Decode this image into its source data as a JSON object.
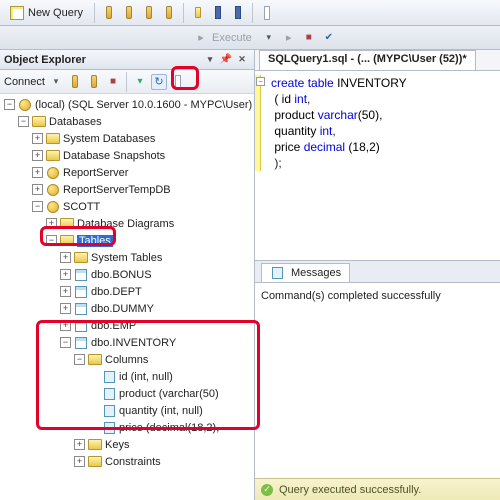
{
  "toolbar": {
    "new_query": "New Query"
  },
  "exec": {
    "execute": "Execute"
  },
  "explorer": {
    "title": "Object Explorer",
    "connect": "Connect",
    "server": "(local) (SQL Server 10.0.1600 - MYPC\\User)",
    "databases": "Databases",
    "system_databases": "System Databases",
    "snapshots": "Database Snapshots",
    "reportserver": "ReportServer",
    "reportservertemp": "ReportServerTempDB",
    "scott": "SCOTT",
    "diagrams": "Database Diagrams",
    "tables": "Tables",
    "system_tables": "System Tables",
    "bonus": "dbo.BONUS",
    "dept": "dbo.DEPT",
    "dummy": "dbo.DUMMY",
    "emp": "dbo.EMP",
    "inventory": "dbo.INVENTORY",
    "columns": "Columns",
    "col_id": "id (int, null)",
    "col_product": "product (varchar(50)",
    "col_quantity": "quantity (int, null)",
    "col_price": "price (decimal(18,2),",
    "keys": "Keys",
    "constraints": "Constraints"
  },
  "editor": {
    "tab_title": "SQLQuery1.sql - (... (MYPC\\User (52))*",
    "l1a": "create",
    "l1b": "table",
    "l1c": "INVENTORY",
    "l2a": "( id",
    "l2b": "int",
    "l2c": ",",
    "l3a": "product",
    "l3b": "varchar",
    "l3c": "(50),",
    "l4a": "quantity",
    "l4b": "int",
    "l4c": ",",
    "l5a": "price",
    "l5b": "decimal",
    "l5c": "(18,2)",
    "l6": ");"
  },
  "messages": {
    "tab": "Messages",
    "text": "Command(s) completed successfully"
  },
  "status": {
    "text": "Query executed successfully."
  },
  "chart_data": null
}
